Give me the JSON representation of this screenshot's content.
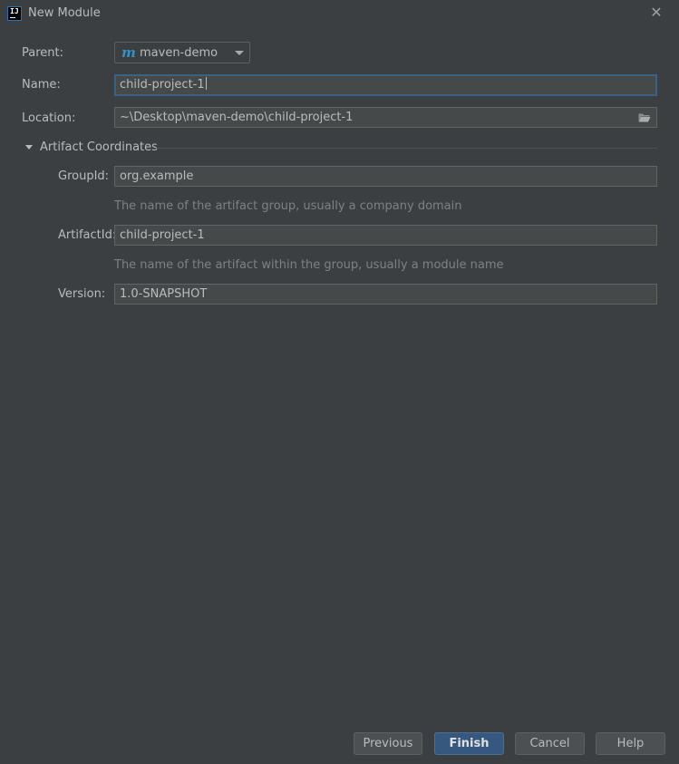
{
  "window": {
    "title": "New Module",
    "close_glyph": "✕"
  },
  "app_icon": {
    "label": "IJ",
    "name": "intellij-icon"
  },
  "form": {
    "parent_label": "Parent:",
    "parent_value": "maven-demo",
    "parent_icon": "m",
    "name_label": "Name:",
    "name_value": "child-project-1",
    "location_label": "Location:",
    "location_value": "~\\Desktop\\maven-demo\\child-project-1"
  },
  "artifact": {
    "section_title": "Artifact Coordinates",
    "groupid_label": "GroupId:",
    "groupid_value": "org.example",
    "groupid_hint": "The name of the artifact group, usually a company domain",
    "artifactid_label": "ArtifactId:",
    "artifactid_value": "child-project-1",
    "artifactid_hint": "The name of the artifact within the group, usually a module name",
    "version_label": "Version:",
    "version_value": "1.0-SNAPSHOT"
  },
  "buttons": {
    "previous": "Previous",
    "finish": "Finish",
    "cancel": "Cancel",
    "help": "Help"
  },
  "colors": {
    "background": "#3c3f41",
    "field_background": "#45494a",
    "focus_border": "#3d6185",
    "primary_button": "#365880",
    "maven_icon": "#3592c4"
  }
}
